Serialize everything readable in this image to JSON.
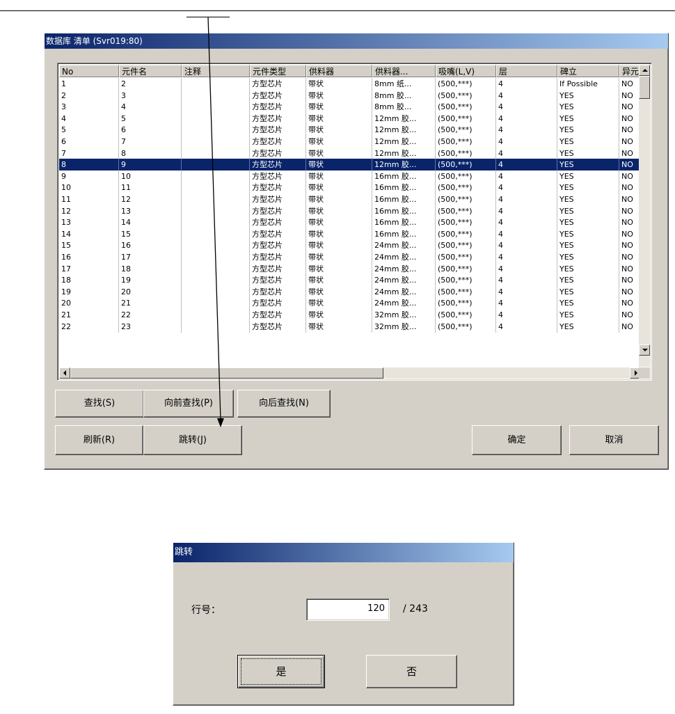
{
  "main_dialog": {
    "title": "数据库 清单 (Svr019:80)",
    "columns": [
      "No",
      "元件名",
      "注释",
      "元件类型",
      "供料器",
      "供料器...",
      "吸嘴(L,V)",
      "层",
      "碑立",
      "异元"
    ],
    "rows": [
      [
        "1",
        "2",
        "",
        "方型芯片",
        "带状",
        "8mm 纸...",
        "(500,***)",
        "4",
        "If Possible",
        "NO"
      ],
      [
        "2",
        "3",
        "",
        "方型芯片",
        "带状",
        "8mm 胶...",
        "(500,***)",
        "4",
        "YES",
        "NO"
      ],
      [
        "3",
        "4",
        "",
        "方型芯片",
        "带状",
        "8mm 胶...",
        "(500,***)",
        "4",
        "YES",
        "NO"
      ],
      [
        "4",
        "5",
        "",
        "方型芯片",
        "带状",
        "12mm 胶...",
        "(500,***)",
        "4",
        "YES",
        "NO"
      ],
      [
        "5",
        "6",
        "",
        "方型芯片",
        "带状",
        "12mm 胶...",
        "(500,***)",
        "4",
        "YES",
        "NO"
      ],
      [
        "6",
        "7",
        "",
        "方型芯片",
        "带状",
        "12mm 胶...",
        "(500,***)",
        "4",
        "YES",
        "NO"
      ],
      [
        "7",
        "8",
        "",
        "方型芯片",
        "带状",
        "12mm 胶...",
        "(500,***)",
        "4",
        "YES",
        "NO"
      ],
      [
        "8",
        "9",
        "",
        "方型芯片",
        "带状",
        "12mm 胶...",
        "(500,***)",
        "4",
        "YES",
        "NO"
      ],
      [
        "9",
        "10",
        "",
        "方型芯片",
        "带状",
        "16mm 胶...",
        "(500,***)",
        "4",
        "YES",
        "NO"
      ],
      [
        "10",
        "11",
        "",
        "方型芯片",
        "带状",
        "16mm 胶...",
        "(500,***)",
        "4",
        "YES",
        "NO"
      ],
      [
        "11",
        "12",
        "",
        "方型芯片",
        "带状",
        "16mm 胶...",
        "(500,***)",
        "4",
        "YES",
        "NO"
      ],
      [
        "12",
        "13",
        "",
        "方型芯片",
        "带状",
        "16mm 胶...",
        "(500,***)",
        "4",
        "YES",
        "NO"
      ],
      [
        "13",
        "14",
        "",
        "方型芯片",
        "带状",
        "16mm 胶...",
        "(500,***)",
        "4",
        "YES",
        "NO"
      ],
      [
        "14",
        "15",
        "",
        "方型芯片",
        "带状",
        "16mm 胶...",
        "(500,***)",
        "4",
        "YES",
        "NO"
      ],
      [
        "15",
        "16",
        "",
        "方型芯片",
        "带状",
        "24mm 胶...",
        "(500,***)",
        "4",
        "YES",
        "NO"
      ],
      [
        "16",
        "17",
        "",
        "方型芯片",
        "带状",
        "24mm 胶...",
        "(500,***)",
        "4",
        "YES",
        "NO"
      ],
      [
        "17",
        "18",
        "",
        "方型芯片",
        "带状",
        "24mm 胶...",
        "(500,***)",
        "4",
        "YES",
        "NO"
      ],
      [
        "18",
        "19",
        "",
        "方型芯片",
        "带状",
        "24mm 胶...",
        "(500,***)",
        "4",
        "YES",
        "NO"
      ],
      [
        "19",
        "20",
        "",
        "方型芯片",
        "带状",
        "24mm 胶...",
        "(500,***)",
        "4",
        "YES",
        "NO"
      ],
      [
        "20",
        "21",
        "",
        "方型芯片",
        "带状",
        "24mm 胶...",
        "(500,***)",
        "4",
        "YES",
        "NO"
      ],
      [
        "21",
        "22",
        "",
        "方型芯片",
        "带状",
        "32mm 胶...",
        "(500,***)",
        "4",
        "YES",
        "NO"
      ],
      [
        "22",
        "23",
        "",
        "方型芯片",
        "带状",
        "32mm 胶...",
        "(500,***)",
        "4",
        "YES",
        "NO"
      ]
    ],
    "selected_row_number": "8",
    "buttons": {
      "find": "查找(S)",
      "find_prev": "向前查找(P)",
      "find_next": "向后查找(N)",
      "refresh": "刷新(R)",
      "jump": "跳转(J)",
      "ok": "确定",
      "cancel": "取消"
    }
  },
  "jump_dialog": {
    "title": "跳转",
    "row_label": "行号：",
    "row_value": "120",
    "total": "/ 243",
    "yes_button": "是",
    "no_button": "否"
  },
  "colors": {
    "title_gradient_start": "#0a246a",
    "title_gradient_end": "#a6caf0",
    "selection": "#0a246a",
    "dialog_face": "#d4d0c8"
  }
}
